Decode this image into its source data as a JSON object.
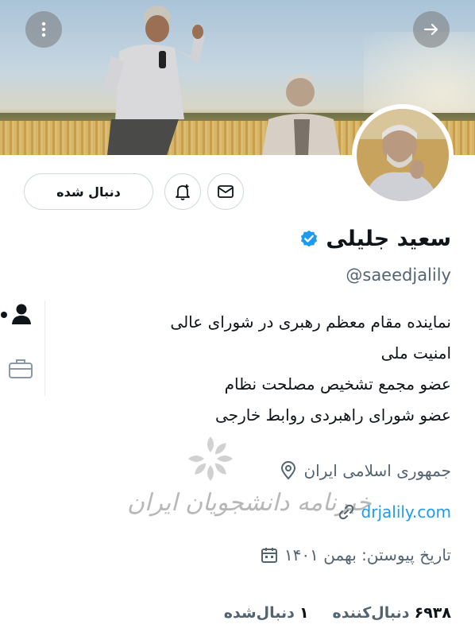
{
  "header": {
    "more_icon": "more-vertical-icon",
    "forward_icon": "arrow-right-icon"
  },
  "profile": {
    "name": "سعید جلیلی",
    "verified": true,
    "handle": "@saeedjalily",
    "bio_lines": [
      "نماینده مقام معظم رهبری در شورای عالی",
      "امنیت ملی",
      "عضو مجمع تشخیص مصلحت نظام",
      "عضو شورای راهبردی روابط خارجی"
    ],
    "location": "جمهوری اسلامی ایران",
    "website": "drjalily.com",
    "joined": "تاریخ پیوستن: بهمن ۱۴۰۱",
    "following_count": "۱",
    "following_label": "دنبال‌شده",
    "followers_count": "۶۹۳۸",
    "followers_label": "دنبال‌کننده"
  },
  "actions": {
    "follow_label": "دنبال شده"
  },
  "watermark": {
    "text": "خبرنامه دانشجویان ایران"
  },
  "colors": {
    "accent": "#1d9bf0",
    "verified": "#1d9bf0",
    "muted": "#536471",
    "border": "#cfd9de"
  }
}
